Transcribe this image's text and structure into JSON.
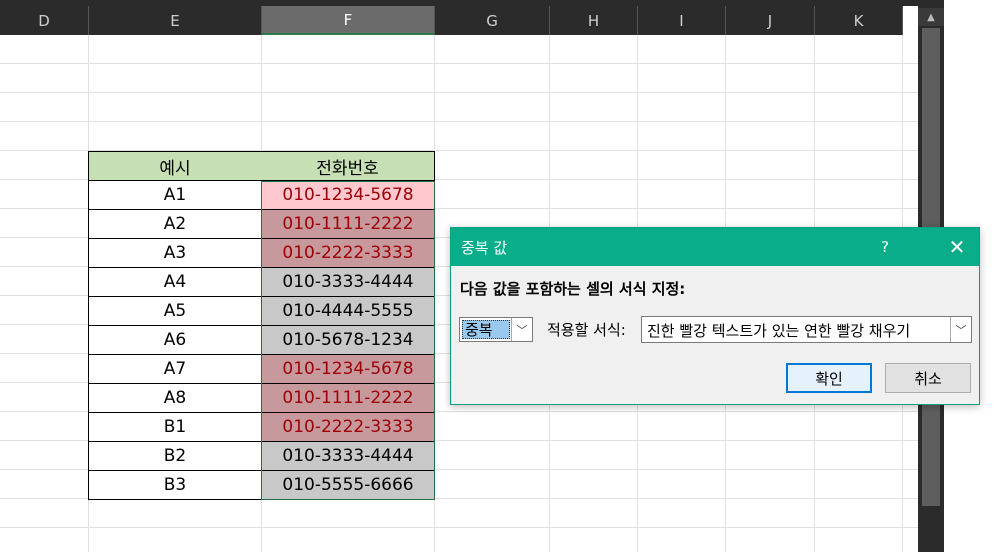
{
  "columns": [
    "D",
    "E",
    "F",
    "G",
    "H",
    "I",
    "J",
    "K"
  ],
  "selected_column": "F",
  "table": {
    "headers": [
      "예시",
      "전화번호"
    ],
    "header_fill": "#c6e0b4",
    "rows": [
      {
        "label": "A1",
        "phone": "010-1234-5678",
        "style": "light"
      },
      {
        "label": "A2",
        "phone": "010-1111-2222",
        "style": "dup"
      },
      {
        "label": "A3",
        "phone": "010-2222-3333",
        "style": "dup"
      },
      {
        "label": "A4",
        "phone": "010-3333-4444",
        "style": "gray"
      },
      {
        "label": "A5",
        "phone": "010-4444-5555",
        "style": "gray"
      },
      {
        "label": "A6",
        "phone": "010-5678-1234",
        "style": "gray"
      },
      {
        "label": "A7",
        "phone": "010-1234-5678",
        "style": "dup"
      },
      {
        "label": "A8",
        "phone": "010-1111-2222",
        "style": "dup"
      },
      {
        "label": "B1",
        "phone": "010-2222-3333",
        "style": "dup"
      },
      {
        "label": "B2",
        "phone": "010-3333-4444",
        "style": "gray"
      },
      {
        "label": "B3",
        "phone": "010-5555-6666",
        "style": "gray"
      }
    ],
    "styles": {
      "light": {
        "fill": "#ffc7ce",
        "text": "#9c0006"
      },
      "dup": {
        "fill": "#c8999c",
        "text": "#9c0006"
      },
      "gray": {
        "fill": "#c8c8c8",
        "text": "#000000"
      }
    }
  },
  "dialog": {
    "title": "중복 값",
    "help": "?",
    "close": "✕",
    "prompt": "다음 값을 포함하는 셀의 서식 지정:",
    "dup_value": "중복",
    "format_label": "적용할 서식:",
    "format_value": "진한 빨강 텍스트가 있는 연한 빨강 채우기",
    "ok_label": "확인",
    "cancel_label": "취소",
    "accent": "#0aad8a"
  },
  "icons": {
    "dropdown": "chevron-down-icon",
    "close": "close-icon",
    "scroll_up": "arrow-up-icon"
  }
}
